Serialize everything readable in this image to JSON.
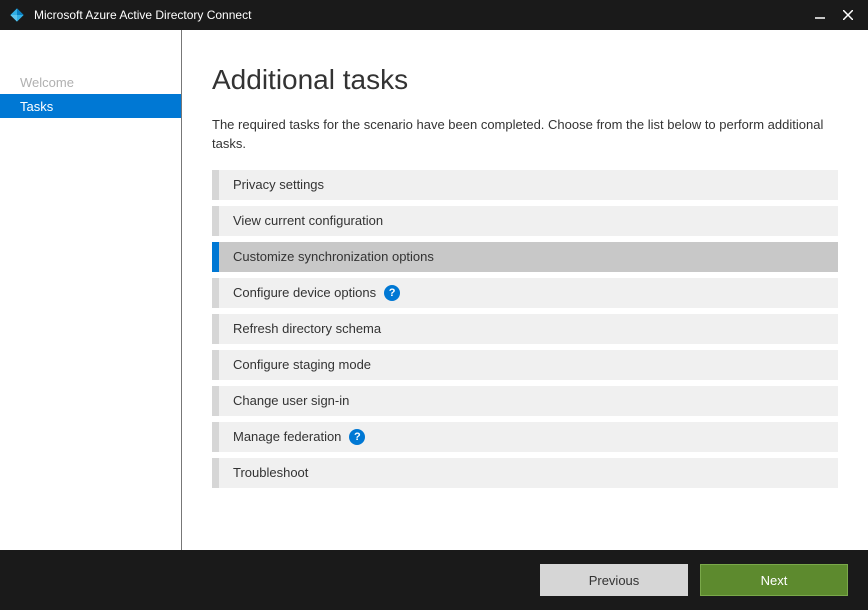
{
  "titlebar": {
    "title": "Microsoft Azure Active Directory Connect"
  },
  "sidebar": {
    "items": [
      {
        "label": "Welcome",
        "state": "completed"
      },
      {
        "label": "Tasks",
        "state": "active"
      }
    ]
  },
  "main": {
    "heading": "Additional tasks",
    "description": "The required tasks for the scenario have been completed. Choose from the list below to perform additional tasks.",
    "tasks": [
      {
        "label": "Privacy settings",
        "selected": false,
        "help": false
      },
      {
        "label": "View current configuration",
        "selected": false,
        "help": false
      },
      {
        "label": "Customize synchronization options",
        "selected": true,
        "help": false
      },
      {
        "label": "Configure device options",
        "selected": false,
        "help": true
      },
      {
        "label": "Refresh directory schema",
        "selected": false,
        "help": false
      },
      {
        "label": "Configure staging mode",
        "selected": false,
        "help": false
      },
      {
        "label": "Change user sign-in",
        "selected": false,
        "help": false
      },
      {
        "label": "Manage federation",
        "selected": false,
        "help": true
      },
      {
        "label": "Troubleshoot",
        "selected": false,
        "help": false
      }
    ]
  },
  "footer": {
    "previous_label": "Previous",
    "next_label": "Next"
  }
}
